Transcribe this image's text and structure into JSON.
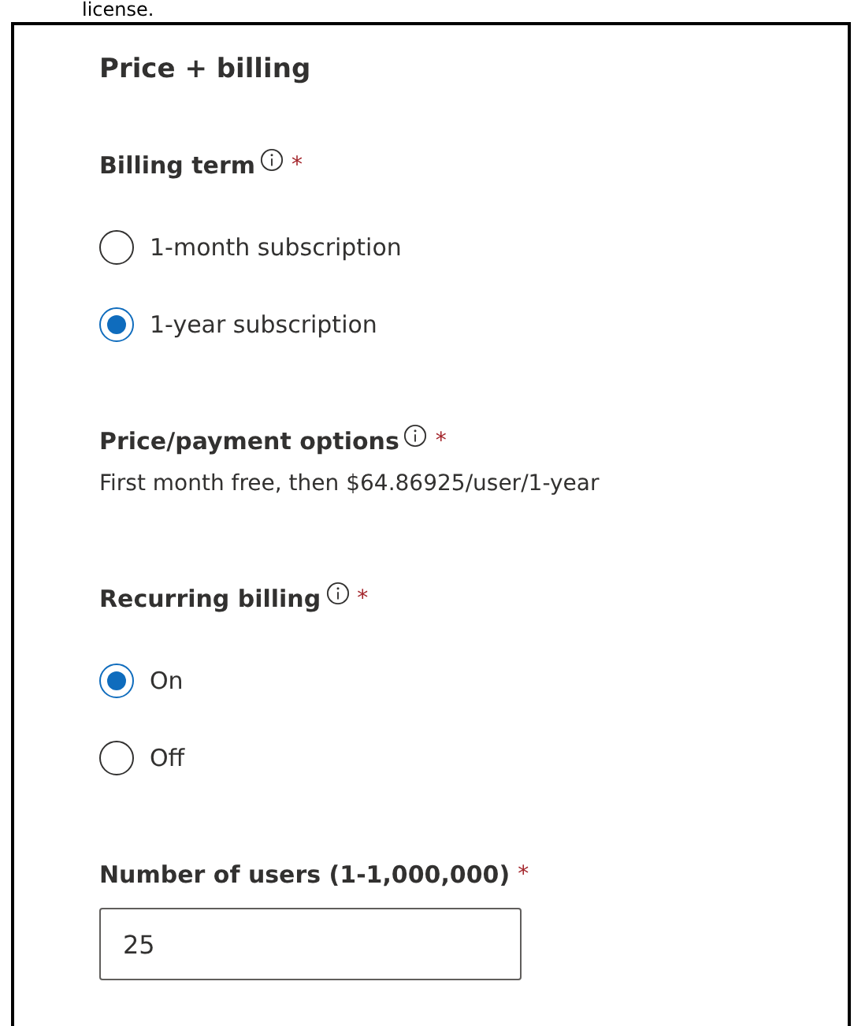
{
  "top_text": "license.",
  "section_title": "Price + billing",
  "fields": [
    {
      "kind": "radio",
      "label": "Billing term",
      "info": true,
      "required": "*",
      "options": [
        {
          "label": "1-month subscription",
          "selected": false
        },
        {
          "label": "1-year subscription",
          "selected": true
        }
      ]
    },
    {
      "kind": "text",
      "label": "Price/payment options",
      "info": true,
      "required": "*",
      "value": "First month free, then $64.86925/user/1-year"
    },
    {
      "kind": "radio",
      "label": "Recurring billing",
      "info": true,
      "required": "*",
      "options": [
        {
          "label": "On",
          "selected": true
        },
        {
          "label": "Off",
          "selected": false
        }
      ]
    },
    {
      "kind": "input",
      "label": "Number of users (1-1,000,000)",
      "info": false,
      "required": "*",
      "value": "25"
    }
  ]
}
